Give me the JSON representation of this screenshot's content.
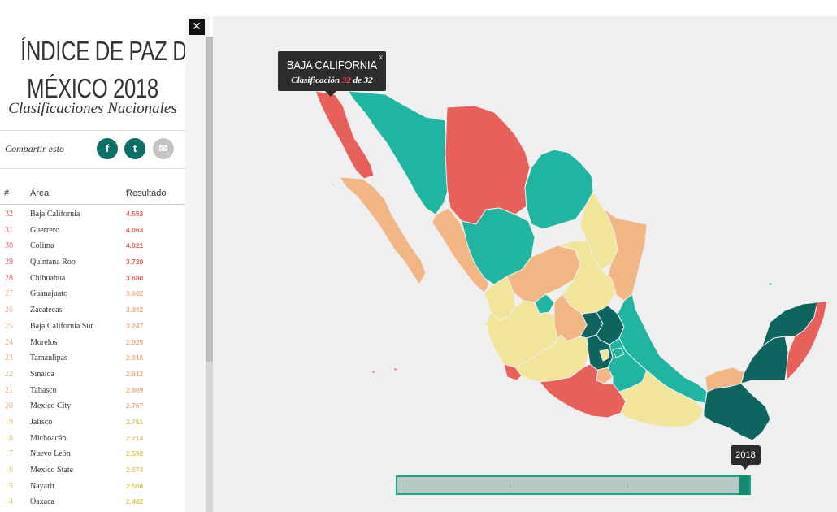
{
  "panel": {
    "title_line1": "ÍNDICE DE PAZ DE",
    "title_line2": "MÉXICO 2018",
    "subtitle": "Clasificaciones Nacionales",
    "share_label": "Compartir esto",
    "share_icons": [
      "facebook-icon",
      "twitter-icon",
      "email-icon"
    ],
    "share_glyphs": {
      "facebook": "f",
      "twitter": "t",
      "email": "✉"
    },
    "columns": {
      "rank": "#",
      "area": "Área",
      "score": "Resultado"
    },
    "rows": [
      {
        "rank": "32",
        "area": "Baja California",
        "score": "4.553"
      },
      {
        "rank": "31",
        "area": "Guerrero",
        "score": "4.063"
      },
      {
        "rank": "30",
        "area": "Colima",
        "score": "4.021"
      },
      {
        "rank": "29",
        "area": "Quintana Roo",
        "score": "3.720"
      },
      {
        "rank": "28",
        "area": "Chihuahua",
        "score": "3.680"
      },
      {
        "rank": "27",
        "area": "Guanajuato",
        "score": "3.602"
      },
      {
        "rank": "26",
        "area": "Zacatecas",
        "score": "3.392"
      },
      {
        "rank": "25",
        "area": "Baja California Sur",
        "score": "3.247"
      },
      {
        "rank": "24",
        "area": "Morelos",
        "score": "2.925"
      },
      {
        "rank": "23",
        "area": "Tamaulipas",
        "score": "2.916"
      },
      {
        "rank": "22",
        "area": "Sinaloa",
        "score": "2.912"
      },
      {
        "rank": "21",
        "area": "Tabasco",
        "score": "2.809"
      },
      {
        "rank": "20",
        "area": "Mexico City",
        "score": "2.767"
      },
      {
        "rank": "19",
        "area": "Jalisco",
        "score": "2.761"
      },
      {
        "rank": "18",
        "area": "Michoacán",
        "score": "2.714"
      },
      {
        "rank": "17",
        "area": "Nuevo León",
        "score": "2.592"
      },
      {
        "rank": "16",
        "area": "Mexico State",
        "score": "2.574"
      },
      {
        "rank": "15",
        "area": "Nayarit",
        "score": "2.568"
      },
      {
        "rank": "14",
        "area": "Oaxaca",
        "score": "2.482"
      }
    ]
  },
  "close_glyph": "✕",
  "tooltip": {
    "title": "BAJA CALIFORNIA",
    "prefix": "Clasificación ",
    "rank": "32",
    "suffix": " de 32",
    "close": "x"
  },
  "timeline": {
    "year": "2018"
  },
  "colors": {
    "very_low": "#e84b4b",
    "low": "#f0b27f",
    "medium": "#f1e59a",
    "high": "#1fb5a0",
    "very_high": "#0e6560",
    "rank_red": "#e06060",
    "rank_orange": "#eab088",
    "rank_yellow": "#d8c567"
  }
}
